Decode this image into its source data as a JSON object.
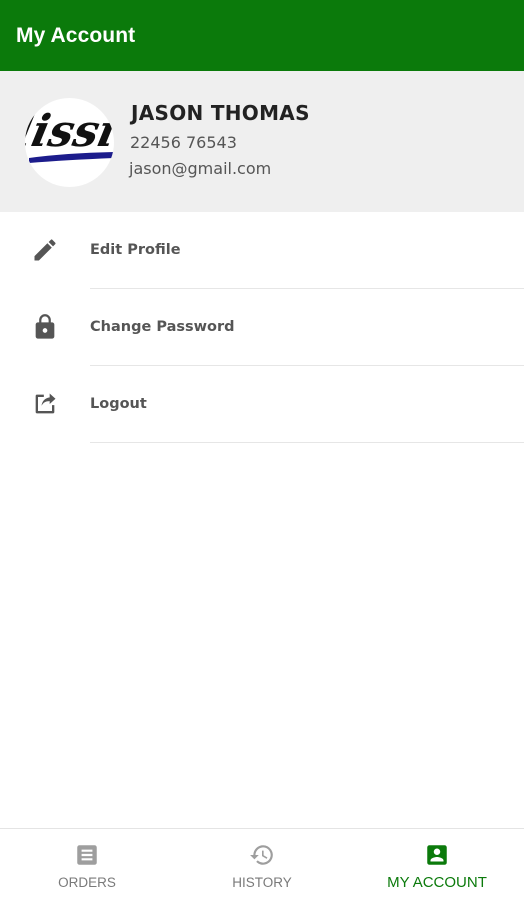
{
  "app_bar": {
    "title": "My Account"
  },
  "profile": {
    "avatar_icon": "brand-logo-avatar",
    "name": "JASON THOMAS",
    "phone": "22456 76543",
    "email": "jason@gmail.com"
  },
  "menu": {
    "items": [
      {
        "icon": "pencil-icon",
        "label": "Edit Profile"
      },
      {
        "icon": "lock-icon",
        "label": "Change Password"
      },
      {
        "icon": "share-icon",
        "label": "Logout"
      }
    ]
  },
  "bottom_nav": {
    "items": [
      {
        "icon": "list-icon",
        "label": "ORDERS",
        "active": false
      },
      {
        "icon": "history-icon",
        "label": "HISTORY",
        "active": false
      },
      {
        "icon": "account-box-icon",
        "label": "MY ACCOUNT",
        "active": true
      }
    ]
  },
  "colors": {
    "primary": "#0b7a0b",
    "profile_background": "#efefef",
    "inactive_nav": "#7a7a7a"
  }
}
